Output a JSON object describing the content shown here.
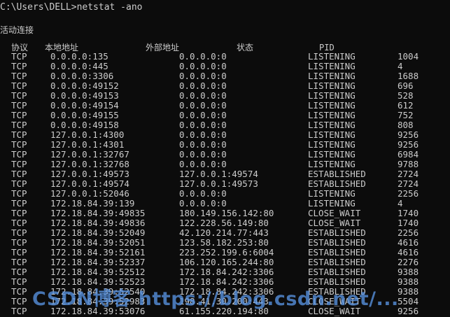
{
  "terminal": {
    "prompt_line": "C:\\Users\\DELL>netstat -ano",
    "section_title": "活动连接",
    "headers": {
      "proto": "协议",
      "local": "本地地址",
      "foreign": "外部地址",
      "state": "状态",
      "pid": "PID"
    },
    "rows": [
      {
        "proto": "TCP",
        "local": "0.0.0.0:135",
        "foreign": "0.0.0.0:0",
        "state": "LISTENING",
        "pid": "1004"
      },
      {
        "proto": "TCP",
        "local": "0.0.0.0:445",
        "foreign": "0.0.0.0:0",
        "state": "LISTENING",
        "pid": "4"
      },
      {
        "proto": "TCP",
        "local": "0.0.0.0:3306",
        "foreign": "0.0.0.0:0",
        "state": "LISTENING",
        "pid": "1688"
      },
      {
        "proto": "TCP",
        "local": "0.0.0.0:49152",
        "foreign": "0.0.0.0:0",
        "state": "LISTENING",
        "pid": "696"
      },
      {
        "proto": "TCP",
        "local": "0.0.0.0:49153",
        "foreign": "0.0.0.0:0",
        "state": "LISTENING",
        "pid": "528"
      },
      {
        "proto": "TCP",
        "local": "0.0.0.0:49154",
        "foreign": "0.0.0.0:0",
        "state": "LISTENING",
        "pid": "612"
      },
      {
        "proto": "TCP",
        "local": "0.0.0.0:49155",
        "foreign": "0.0.0.0:0",
        "state": "LISTENING",
        "pid": "752"
      },
      {
        "proto": "TCP",
        "local": "0.0.0.0:49158",
        "foreign": "0.0.0.0:0",
        "state": "LISTENING",
        "pid": "808"
      },
      {
        "proto": "TCP",
        "local": "127.0.0.1:4300",
        "foreign": "0.0.0.0:0",
        "state": "LISTENING",
        "pid": "9256"
      },
      {
        "proto": "TCP",
        "local": "127.0.0.1:4301",
        "foreign": "0.0.0.0:0",
        "state": "LISTENING",
        "pid": "9256"
      },
      {
        "proto": "TCP",
        "local": "127.0.0.1:32767",
        "foreign": "0.0.0.0:0",
        "state": "LISTENING",
        "pid": "6984"
      },
      {
        "proto": "TCP",
        "local": "127.0.0.1:32768",
        "foreign": "0.0.0.0:0",
        "state": "LISTENING",
        "pid": "9788"
      },
      {
        "proto": "TCP",
        "local": "127.0.0.1:49573",
        "foreign": "127.0.0.1:49574",
        "state": "ESTABLISHED",
        "pid": "2724"
      },
      {
        "proto": "TCP",
        "local": "127.0.0.1:49574",
        "foreign": "127.0.0.1:49573",
        "state": "ESTABLISHED",
        "pid": "2724"
      },
      {
        "proto": "TCP",
        "local": "127.0.0.1:52046",
        "foreign": "0.0.0.0:0",
        "state": "LISTENING",
        "pid": "2256"
      },
      {
        "proto": "TCP",
        "local": "172.18.84.39:139",
        "foreign": "0.0.0.0:0",
        "state": "LISTENING",
        "pid": "4"
      },
      {
        "proto": "TCP",
        "local": "172.18.84.39:49835",
        "foreign": "180.149.156.142:80",
        "state": "CLOSE_WAIT",
        "pid": "1740"
      },
      {
        "proto": "TCP",
        "local": "172.18.84.39:49836",
        "foreign": "122.228.56.149:80",
        "state": "CLOSE_WAIT",
        "pid": "1740"
      },
      {
        "proto": "TCP",
        "local": "172.18.84.39:52049",
        "foreign": "42.120.214.77:443",
        "state": "ESTABLISHED",
        "pid": "2256"
      },
      {
        "proto": "TCP",
        "local": "172.18.84.39:52051",
        "foreign": "123.58.182.253:80",
        "state": "ESTABLISHED",
        "pid": "4616"
      },
      {
        "proto": "TCP",
        "local": "172.18.84.39:52161",
        "foreign": "223.252.199.6:6004",
        "state": "ESTABLISHED",
        "pid": "4616"
      },
      {
        "proto": "TCP",
        "local": "172.18.84.39:52337",
        "foreign": "106.120.165.244:80",
        "state": "ESTABLISHED",
        "pid": "2276"
      },
      {
        "proto": "TCP",
        "local": "172.18.84.39:52512",
        "foreign": "172.18.84.242:3306",
        "state": "ESTABLISHED",
        "pid": "9388"
      },
      {
        "proto": "TCP",
        "local": "172.18.84.39:52523",
        "foreign": "172.18.84.242:3306",
        "state": "ESTABLISHED",
        "pid": "9388"
      },
      {
        "proto": "TCP",
        "local": "172.18.84.39:52540",
        "foreign": "172.18.84.242:3306",
        "state": "ESTABLISHED",
        "pid": "9388"
      },
      {
        "proto": "TCP",
        "local": "172.18.84.39:52983",
        "foreign": "198.41.30.200:443",
        "state": "CLOSE_WAIT",
        "pid": "5504"
      },
      {
        "proto": "TCP",
        "local": "172.18.84.39:53076",
        "foreign": "61.155.220.194:80",
        "state": "CLOSE_WAIT",
        "pid": "9256"
      }
    ]
  },
  "watermark": {
    "text": "CSDN博客 https://blog.csdn.net/..."
  },
  "colors": {
    "background": "#0c0c0c",
    "text": "#cccccc",
    "watermark": "#5894e2"
  }
}
